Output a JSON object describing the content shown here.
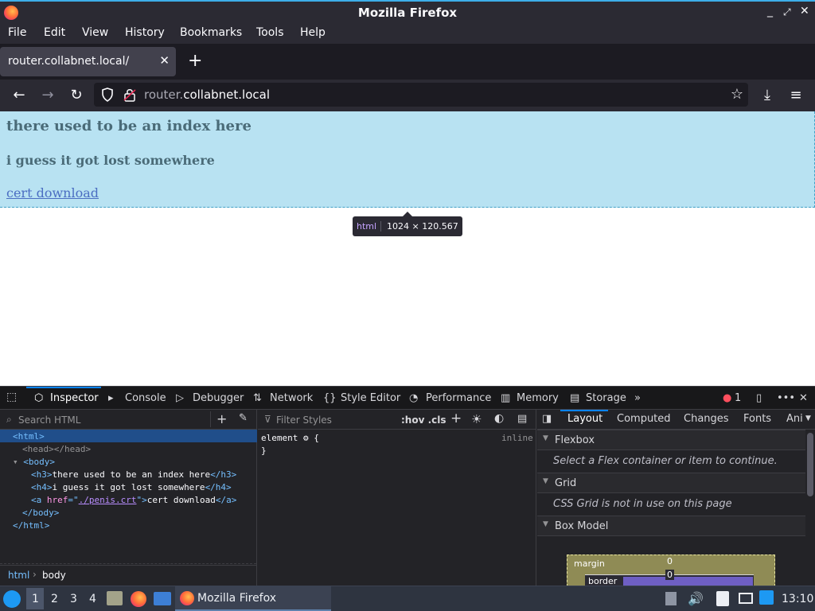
{
  "window": {
    "title": "Mozilla Firefox",
    "controls": [
      "_",
      "⤢",
      "✕"
    ]
  },
  "menu": [
    "File",
    "Edit",
    "View",
    "History",
    "Bookmarks",
    "Tools",
    "Help"
  ],
  "tab": {
    "title": "router.collabnet.local/",
    "close": "✕",
    "new": "+"
  },
  "url": {
    "prefix": "router.",
    "domain": "collabnet.local"
  },
  "page": {
    "h3": "there used to be an index here",
    "h4": "i guess it got lost somewhere",
    "link": "cert download"
  },
  "infobar": {
    "tag": "html",
    "dims": "1024 × 120.567"
  },
  "devtools": {
    "tabs": [
      "Inspector",
      "Console",
      "Debugger",
      "Network",
      "Style Editor",
      "Performance",
      "Memory",
      "Storage"
    ],
    "errors": "1",
    "search_placeholder": "Search HTML",
    "filter_placeholder": "Filter Styles",
    "hov_cls": ":hov .cls",
    "html_tree": {
      "html_open": "<html>",
      "head": "<head></head>",
      "body_open": "<body>",
      "h3_text": "there used to be an index here",
      "h4_text": "i guess it got lost somewhere",
      "a_href": "./penis.crt",
      "a_text": "cert download",
      "body_close": "</body>",
      "html_close": "</html>"
    },
    "rule": {
      "selector": "element",
      "source": "inline",
      "close": "}"
    },
    "layout_tabs": [
      "Layout",
      "Computed",
      "Changes",
      "Fonts",
      "Ani"
    ],
    "flexbox": {
      "title": "Flexbox",
      "msg": "Select a Flex container or item to continue."
    },
    "grid": {
      "title": "Grid",
      "msg": "CSS Grid is not in use on this page"
    },
    "boxmodel": {
      "title": "Box Model",
      "margin_label": "margin",
      "margin_val": "0",
      "border_label": "border",
      "border_val": "0"
    },
    "breadcrumb": [
      "html",
      "body"
    ]
  },
  "taskbar": {
    "desktops": [
      "1",
      "2",
      "3",
      "4"
    ],
    "task": "Mozilla Firefox",
    "time": "13:10"
  }
}
